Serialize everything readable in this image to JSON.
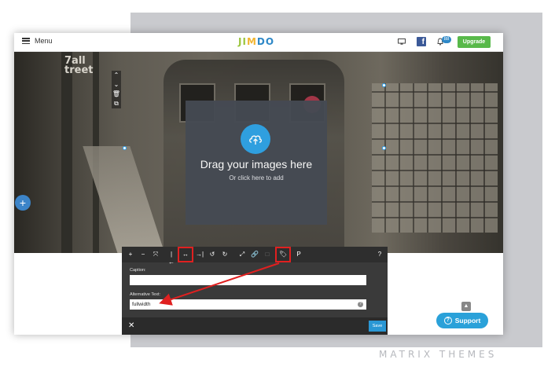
{
  "topbar": {
    "menu_label": "Menu",
    "logo_letters": [
      {
        "char": "J",
        "color": "#9bc53d"
      },
      {
        "char": "I",
        "color": "#9bc53d"
      },
      {
        "char": "M",
        "color": "#f2b632"
      },
      {
        "char": "D",
        "color": "#2e88c7"
      },
      {
        "char": "O",
        "color": "#2e88c7"
      }
    ],
    "facebook_letter": "f",
    "notification_count": "88",
    "upgrade_label": "Upgrade"
  },
  "hero": {
    "sign_line1": "7all",
    "sign_line2": "treet",
    "drop_title": "Drag your images here",
    "drop_subtitle": "Or click here to add",
    "add_button": "+",
    "icons": [
      "chevron-up-icon",
      "chevron-down-icon",
      "trash-icon",
      "copy-icon"
    ]
  },
  "editor": {
    "toolbar": [
      "+",
      "−",
      "⤧",
      "|←",
      "↔",
      "→|",
      "↺",
      "↻",
      "⤢",
      "🔗",
      "□",
      "🏷",
      "P",
      "?"
    ],
    "caption_label": "Caption:",
    "caption_value": "",
    "alt_label": "Alternative Text:",
    "alt_value": "fullwidth",
    "close_label": "✕",
    "save_label": "Save"
  },
  "support": {
    "label": "Support",
    "icon_char": "?"
  },
  "watermark": "MATRIX THEMES",
  "colors": {
    "upgrade_green": "#58b94a",
    "upload_blue": "#2ea3e6",
    "highlight_red": "#e02020",
    "support_blue": "#2aa1d9"
  }
}
